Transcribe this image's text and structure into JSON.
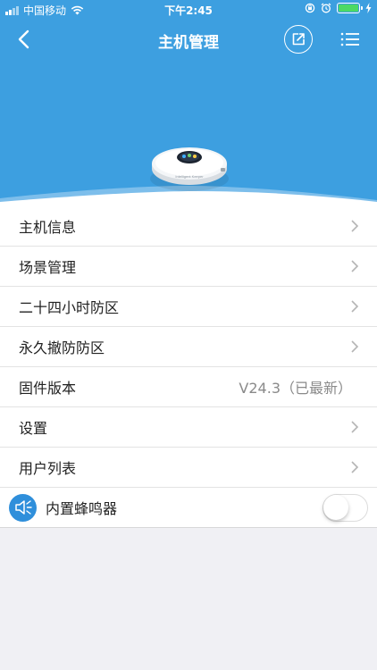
{
  "status_bar": {
    "carrier": "中国移动",
    "time": "下午2:45"
  },
  "nav": {
    "title": "主机管理"
  },
  "device": {
    "brand_text": "Intelligent Keeper"
  },
  "menu": [
    {
      "label": "主机信息"
    },
    {
      "label": "场景管理"
    },
    {
      "label": "二十四小时防区"
    },
    {
      "label": "永久撤防防区"
    },
    {
      "label": "固件版本",
      "value": "V24.3（已最新）"
    },
    {
      "label": "设置"
    },
    {
      "label": "用户列表"
    }
  ],
  "buzzer": {
    "label": "内置蜂鸣器",
    "enabled": false
  },
  "colors": {
    "header_blue": "#3d9fe0",
    "battery_green": "#4cd964"
  }
}
